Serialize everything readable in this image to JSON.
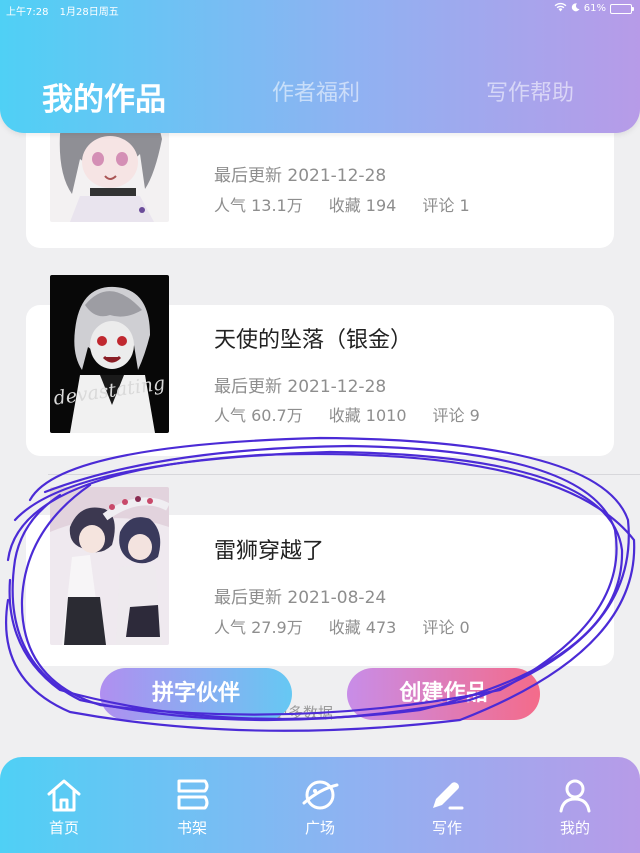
{
  "status": {
    "time": "上午7:28",
    "date": "1月28日周五",
    "battery": "61%",
    "battery_level": 0.61
  },
  "header": {
    "tabs": [
      {
        "label": "我的作品",
        "active": true
      },
      {
        "label": "作者福利",
        "active": false
      },
      {
        "label": "写作帮助",
        "active": false
      }
    ]
  },
  "works": [
    {
      "title": "",
      "updated": "最后更新 2021-12-28",
      "popularity": "人气 13.1万",
      "favorites": "收藏 194",
      "comments": "评论 1"
    },
    {
      "title": "天使的坠落（银金）",
      "updated": "最后更新 2021-12-28",
      "popularity": "人气 60.7万",
      "favorites": "收藏 1010",
      "comments": "评论 9",
      "cover_text": "devastating"
    },
    {
      "title": "雷狮穿越了",
      "updated": "最后更新 2021-08-24",
      "popularity": "人气 27.9万",
      "favorites": "收藏 473",
      "comments": "评论 0"
    }
  ],
  "actions": {
    "partner": "拼字伙伴",
    "create": "创建作品",
    "no_more": "无更多数据"
  },
  "nav": [
    {
      "label": "首页",
      "icon": "home-icon"
    },
    {
      "label": "书架",
      "icon": "bookshelf-icon"
    },
    {
      "label": "广场",
      "icon": "planet-icon"
    },
    {
      "label": "写作",
      "icon": "pen-icon",
      "active": true
    },
    {
      "label": "我的",
      "icon": "user-icon"
    }
  ],
  "colors": {
    "gradient_start": "#4fd0f5",
    "gradient_end": "#b79be8",
    "scribble": "#4b2bd6",
    "create_btn": "#f46b8a"
  }
}
